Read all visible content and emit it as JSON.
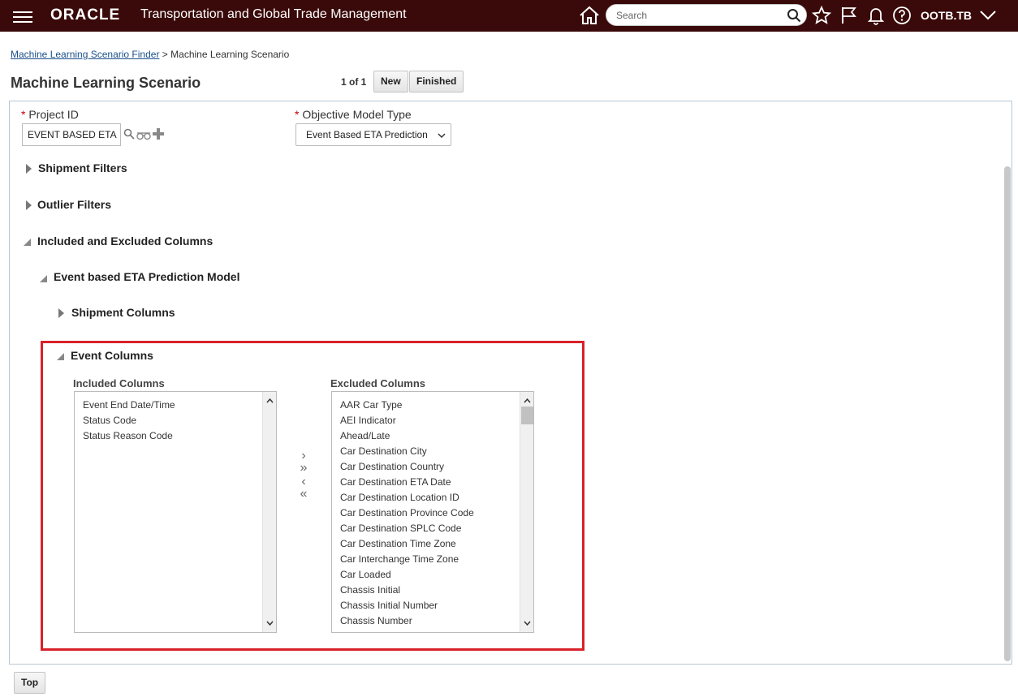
{
  "header": {
    "brand": "ORACLE",
    "app_title": "Transportation and Global Trade Management",
    "search_placeholder": "Search",
    "user": "OOTB.TB"
  },
  "breadcrumb": {
    "link": "Machine Learning Scenario Finder",
    "separator": ">",
    "current": "Machine Learning Scenario"
  },
  "page": {
    "title": "Machine Learning Scenario",
    "pager": "1 of 1",
    "new_label": "New",
    "finished_label": "Finished"
  },
  "form": {
    "required_mark": "*",
    "project_id_label": "Project ID",
    "project_id_value": "EVENT BASED ETA",
    "objective_label": "Objective Model Type",
    "objective_value": "Event Based ETA Prediction"
  },
  "sections": {
    "shipment_filters": "Shipment Filters",
    "outlier_filters": "Outlier Filters",
    "included_excluded": "Included and Excluded Columns",
    "eta_model": "Event based ETA Prediction Model",
    "shipment_columns": "Shipment Columns",
    "event_columns": "Event Columns"
  },
  "event_columns": {
    "included_header": "Included Columns",
    "excluded_header": "Excluded Columns",
    "included": [
      "Event End Date/Time",
      "Status Code",
      "Status Reason Code"
    ],
    "excluded": [
      "AAR Car Type",
      "AEI Indicator",
      "Ahead/Late",
      "Car Destination City",
      "Car Destination Country",
      "Car Destination ETA Date",
      "Car Destination Location ID",
      "Car Destination Province Code",
      "Car Destination SPLC Code",
      "Car Destination Time Zone",
      "Car Interchange Time Zone",
      "Car Loaded",
      "Chassis Initial",
      "Chassis Initial Number",
      "Chassis Number"
    ],
    "move_right": "›",
    "move_all_right": "»",
    "move_left": "‹",
    "move_all_left": "«"
  },
  "footer": {
    "top_label": "Top"
  },
  "colors": {
    "header_bg": "#3a0a0a",
    "highlight": "#d9212a",
    "link": "#1a4f8b"
  }
}
